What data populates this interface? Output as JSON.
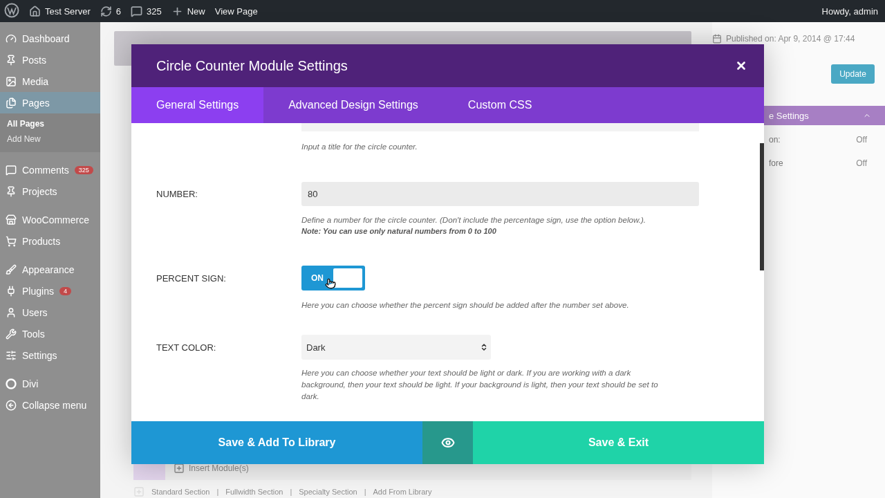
{
  "admin_bar": {
    "items": [
      {
        "kind": "logo"
      },
      {
        "kind": "home",
        "label": "Test Server"
      },
      {
        "kind": "updates",
        "label": "6"
      },
      {
        "kind": "comments",
        "label": "325"
      },
      {
        "kind": "new",
        "label": "New"
      },
      {
        "kind": "text",
        "label": "View Page"
      }
    ],
    "greeting": "Howdy, admin"
  },
  "sidebar": {
    "items": [
      {
        "kind": "dashboard",
        "label": "Dashboard",
        "selected": false
      },
      {
        "kind": "pin",
        "label": "Posts",
        "selected": false
      },
      {
        "kind": "media",
        "label": "Media",
        "selected": false
      },
      {
        "kind": "pages",
        "label": "Pages",
        "selected": true,
        "children": [
          {
            "label": "All Pages",
            "selected": true
          },
          {
            "label": "Add New",
            "selected": false
          }
        ]
      },
      {
        "kind": "comments",
        "label": "Comments",
        "badge": "325",
        "selected": false
      },
      {
        "kind": "pin",
        "label": "Projects",
        "selected": false
      },
      {
        "kind": "store",
        "label": "WooCommerce",
        "selected": false
      },
      {
        "kind": "cart",
        "label": "Products",
        "selected": false
      },
      {
        "kind": "brush",
        "label": "Appearance",
        "selected": false
      },
      {
        "kind": "plug",
        "label": "Plugins",
        "badge": "4",
        "selected": false
      },
      {
        "kind": "user",
        "label": "Users",
        "selected": false
      },
      {
        "kind": "wrench",
        "label": "Tools",
        "selected": false
      },
      {
        "kind": "sliders",
        "label": "Settings",
        "selected": false
      },
      {
        "kind": "circle",
        "label": "Divi",
        "selected": false
      },
      {
        "kind": "collapse",
        "label": "Collapse menu",
        "selected": false
      }
    ]
  },
  "side_panel": {
    "published": "Published on: Apr 9, 2014 @ 17:44",
    "update_button": "Update",
    "settings_title": "e Settings",
    "rows": [
      {
        "label": "on:",
        "value": "Off"
      },
      {
        "label": "fore",
        "value": "Off"
      }
    ]
  },
  "builder": {
    "insert_button": "Insert Module(s)",
    "links": [
      "Standard Section",
      "Fullwidth Section",
      "Specialty Section",
      "Add From Library"
    ],
    "separator": "|"
  },
  "modal": {
    "title": "Circle Counter Module Settings",
    "tabs": [
      {
        "label": "General Settings",
        "selected": true
      },
      {
        "label": "Advanced Design Settings",
        "selected": false
      },
      {
        "label": "Custom CSS",
        "selected": false
      }
    ],
    "fields": [
      {
        "kind": "cut",
        "description": "Input a title for the circle counter."
      },
      {
        "kind": "text",
        "label": "NUMBER:",
        "value": "80",
        "description": "Define a number for the circle counter. (Don't include the percentage sign, use the option below.).",
        "note": "Note: You can use only natural numbers from 0 to 100"
      },
      {
        "kind": "toggle",
        "label": "PERCENT SIGN:",
        "on": true,
        "toggle_label": "ON",
        "description": "Here you can choose whether the percent sign should be added after the number set above."
      },
      {
        "kind": "select",
        "label": "TEXT COLOR:",
        "value": "Dark",
        "description": "Here you can choose whether your text should be light or dark. If you are working with a dark background, then your text should be light. If your background is light, then your text should be set to dark."
      }
    ],
    "buttons": [
      {
        "kind": "library",
        "label": "Save & Add To Library"
      },
      {
        "kind": "preview"
      },
      {
        "kind": "exit",
        "label": "Save & Exit"
      }
    ]
  }
}
